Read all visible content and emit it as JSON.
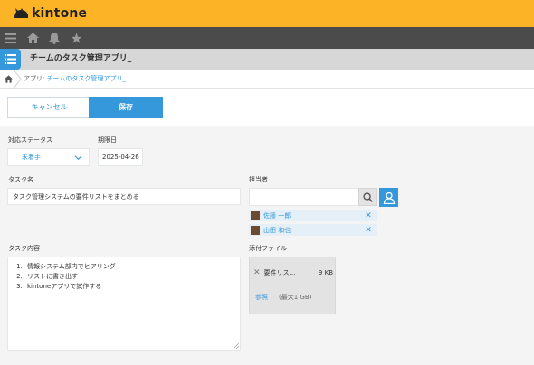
{
  "brand": {
    "name": "kintone"
  },
  "colors": {
    "brand_yellow": "#fcb426",
    "nav_dark": "#4b4b4b",
    "accent_blue": "#3498db",
    "title_gray": "#d7d7d7"
  },
  "global_nav": {
    "icons": [
      "menu-icon",
      "home-icon",
      "bell-icon",
      "star-icon"
    ]
  },
  "app": {
    "title": "チームのタスク管理アプリ_"
  },
  "breadcrumb": {
    "prefix": "アプリ: ",
    "link": "チームのタスク管理アプリ_"
  },
  "actions": {
    "cancel_label": "キャンセル",
    "save_label": "保存"
  },
  "form": {
    "status": {
      "label": "対応ステータス",
      "value": "未着手"
    },
    "due_date": {
      "label": "期限日",
      "value": "2025-04-26"
    },
    "task_name": {
      "label": "タスク名",
      "value": "タスク管理システムの要件リストをまとめる"
    },
    "assignee": {
      "label": "担当者",
      "users": [
        {
          "name": "佐藤 一郎",
          "remove": "✕"
        },
        {
          "name": "山田 和也",
          "remove": "✕"
        }
      ]
    },
    "task_detail": {
      "label": "タスク内容",
      "lines": [
        "情報システム部内でヒアリング",
        "リストに書き出す",
        "kintoneアプリで試作する"
      ]
    },
    "attachment": {
      "label": "添付ファイル",
      "file": {
        "remove": "✕",
        "name": "要件リス…",
        "size": "9 KB"
      },
      "browse_label": "参照",
      "max_label": "(最大1 GB)"
    }
  }
}
